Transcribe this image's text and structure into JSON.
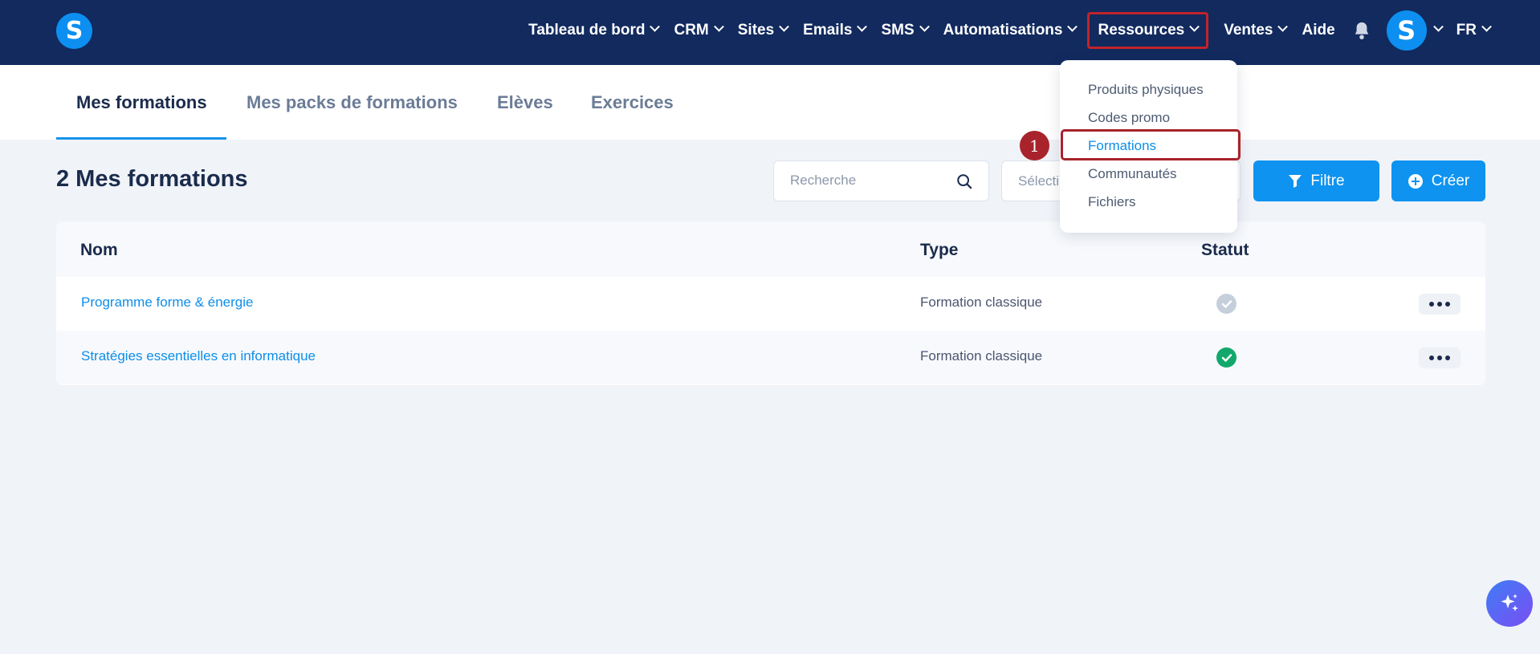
{
  "app": {
    "logo_letter": "S"
  },
  "nav": {
    "items": [
      {
        "label": "Tableau de bord"
      },
      {
        "label": "CRM"
      },
      {
        "label": "Sites"
      },
      {
        "label": "Emails"
      },
      {
        "label": "SMS"
      },
      {
        "label": "Automatisations"
      },
      {
        "label": "Ressources"
      },
      {
        "label": "Ventes"
      },
      {
        "label": "Aide"
      }
    ],
    "avatar_letter": "S",
    "language": "FR"
  },
  "tabs": [
    {
      "label": "Mes formations",
      "active": true
    },
    {
      "label": "Mes packs de formations"
    },
    {
      "label": "Elèves"
    },
    {
      "label": "Exercices"
    }
  ],
  "page": {
    "title": "2 Mes formations",
    "search_placeholder": "Recherche",
    "select_placeholder": "Sélecti",
    "filter_label": "Filtre",
    "create_label": "Créer"
  },
  "table": {
    "headers": {
      "name": "Nom",
      "type": "Type",
      "status": "Statut"
    },
    "rows": [
      {
        "name": "Programme forme & énergie",
        "type": "Formation classique",
        "status": "inactive"
      },
      {
        "name": "Stratégies essentielles en informatique",
        "type": "Formation classique",
        "status": "active"
      }
    ]
  },
  "dropdown": {
    "items": [
      {
        "label": "Produits physiques"
      },
      {
        "label": "Codes promo"
      },
      {
        "label": "Formations",
        "active": true
      },
      {
        "label": "Communautés"
      },
      {
        "label": "Fichiers"
      }
    ]
  },
  "annotation": {
    "step": "1"
  },
  "colors": {
    "navbar": "#122a5e",
    "accent": "#0e93f0",
    "highlight": "#a8232b",
    "status_active": "#12a86b",
    "status_inactive": "#c5cfdc"
  }
}
